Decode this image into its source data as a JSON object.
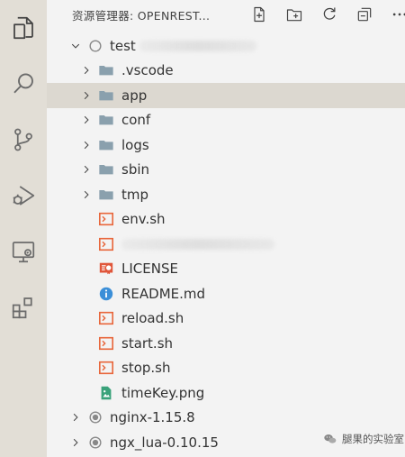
{
  "explorer": {
    "header_title": "资源管理器: OPENREST...",
    "actions": {
      "new_file": "new-file-icon",
      "new_folder": "new-folder-icon",
      "refresh": "refresh-icon",
      "collapse": "collapse-all-icon",
      "more": "more-icon"
    }
  },
  "activity_bar": {
    "items": [
      "explorer-icon",
      "search-icon",
      "source-control-icon",
      "run-debug-icon",
      "remote-explorer-icon",
      "extensions-icon"
    ]
  },
  "tree": {
    "root": {
      "label": "test"
    },
    "folders": [
      ".vscode",
      "app",
      "conf",
      "logs",
      "sbin",
      "tmp"
    ],
    "selected": "app",
    "files": [
      {
        "label": "env.sh",
        "type": "shell"
      },
      {
        "label": "",
        "type": "shell",
        "redacted": true
      },
      {
        "label": "LICENSE",
        "type": "license"
      },
      {
        "label": "README.md",
        "type": "info"
      },
      {
        "label": "reload.sh",
        "type": "shell"
      },
      {
        "label": "start.sh",
        "type": "shell"
      },
      {
        "label": "stop.sh",
        "type": "shell"
      },
      {
        "label": "timeKey.png",
        "type": "image"
      }
    ],
    "other_roots": [
      "nginx-1.15.8",
      "ngx_lua-0.10.15"
    ]
  },
  "watermark": {
    "text": "腿果的实验室"
  },
  "colors": {
    "folder": "#8aa0ad",
    "shell": "#e8663b",
    "info": "#3b8fd8",
    "license": "#e0563a",
    "image": "#3aa27a",
    "selected_bg": "#dcd8d0"
  }
}
